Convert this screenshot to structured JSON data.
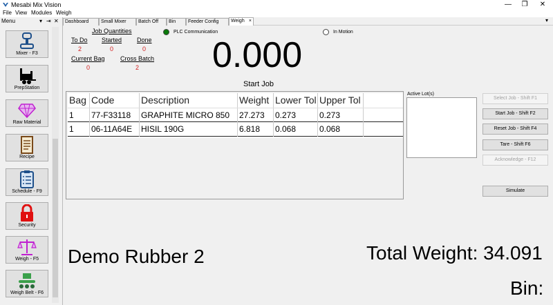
{
  "window": {
    "title": "Mesabi Mix Vision",
    "minimize": "—",
    "restore": "❐",
    "close": "✕"
  },
  "menu": {
    "items": [
      "File",
      "View",
      "Modules",
      "Weigh"
    ]
  },
  "side_panel": {
    "header": "Menu",
    "controls": [
      "▾",
      "⇥",
      "✕"
    ],
    "buttons": [
      {
        "label": "Mixer - F3",
        "icon": "mixer-icon"
      },
      {
        "label": "PrepStation",
        "icon": "forklift-icon"
      },
      {
        "label": "Raw Material",
        "icon": "diamond-icon"
      },
      {
        "label": "Recipe",
        "icon": "recipe-icon"
      },
      {
        "label": "Schedule - F9",
        "icon": "schedule-clipboard-icon"
      },
      {
        "label": "Security",
        "icon": "lock-icon"
      },
      {
        "label": "Weigh - F5",
        "icon": "scale-icon"
      },
      {
        "label": "Weigh Belt - F6",
        "icon": "conveyor-icon"
      }
    ]
  },
  "tabs": [
    {
      "label": "Dashboard"
    },
    {
      "label": "Small Mixer"
    },
    {
      "label": "Batch Off"
    },
    {
      "label": "Bin"
    },
    {
      "label": "Feeder Config"
    },
    {
      "label": "Weigh",
      "active": true,
      "close": "×"
    }
  ],
  "tab_overflow": "▾",
  "weigh": {
    "job_quantities_title": "Job Quantities",
    "to_do_label": "To Do",
    "to_do_value": "2",
    "started_label": "Started",
    "started_value": "0",
    "done_label": "Done",
    "done_value": "0",
    "current_bag_label": "Current Bag",
    "current_bag_value": "0",
    "cross_batch_label": "Cross Batch",
    "cross_batch_value": "2",
    "plc_label": "PLC Communication",
    "plc_color": "#0a7a0a",
    "in_motion_label": "In Motion",
    "weight_display": "0.000",
    "status_text": "Start Job",
    "table": {
      "columns": [
        "Bag",
        "Code",
        "Description",
        "Weight",
        "Lower Tol",
        "Upper Tol"
      ],
      "rows": [
        [
          "1",
          "77-F33118",
          "GRAPHITE MICRO 850",
          "27.273",
          "0.273",
          "0.273"
        ],
        [
          "1",
          "06-11A64E",
          "HISIL 190G",
          "6.818",
          "0.068",
          "0.068"
        ]
      ]
    },
    "active_lots_label": "Active Lot(s)",
    "buttons": {
      "select_job": "Select Job - Shift F1",
      "start_job": "Start Job - Shift F2",
      "reset_job": "Reset Job - Shift F4",
      "tare": "Tare - Shift F6",
      "acknowledge": "Acknowledge - F12",
      "simulate": "Simulate"
    },
    "recipe_name": "Demo Rubber 2",
    "total_weight": "Total Weight: 34.091",
    "bin_label": "Bin:"
  },
  "colors": {
    "red_value": "#d21f1f",
    "accent_purple": "#c020d0",
    "lock_red": "#e01010"
  }
}
